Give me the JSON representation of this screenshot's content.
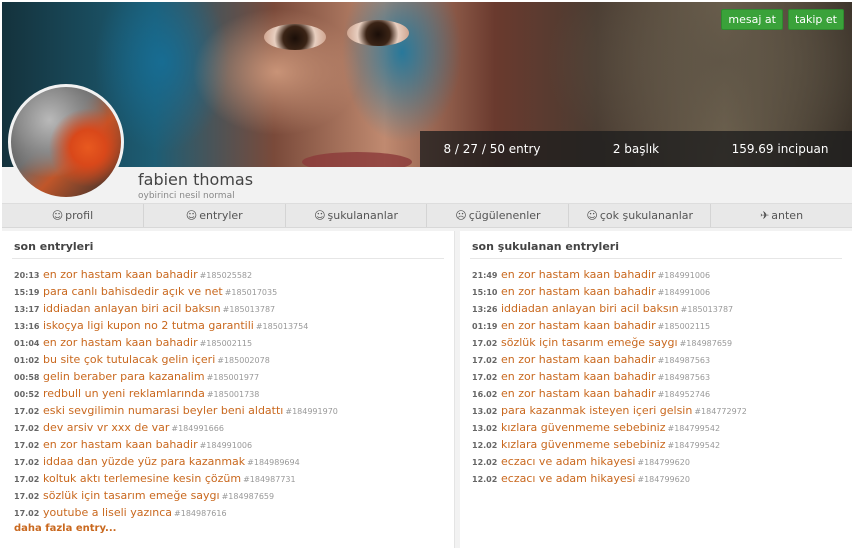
{
  "header": {
    "message_button": "mesaj at",
    "follow_button": "takip et"
  },
  "stats": {
    "entry_counts": "8 / 27 / 50 entry",
    "topics": "2 başlık",
    "points": "159.69 incipuan"
  },
  "profile": {
    "username": "fabien thomas",
    "generation": "oybirinci nesil normal"
  },
  "tabs": [
    {
      "icon": "☺",
      "label": "profil"
    },
    {
      "icon": "☺",
      "label": "entryler"
    },
    {
      "icon": "☺",
      "label": "şukulananlar"
    },
    {
      "icon": "☹",
      "label": "çügülenenler"
    },
    {
      "icon": "☺",
      "label": "çok şukulananlar"
    },
    {
      "icon": "✈",
      "label": "anten"
    }
  ],
  "left_panel": {
    "title": "son entryleri",
    "entries": [
      {
        "time": "20:13",
        "title": "en zor hastam kaan bahadir",
        "id": "#185025582"
      },
      {
        "time": "15:19",
        "title": "para canlı bahisdedir açık ve net",
        "id": "#185017035"
      },
      {
        "time": "13:17",
        "title": "iddiadan anlayan biri acil baksın",
        "id": "#185013787"
      },
      {
        "time": "13:16",
        "title": "iskoçya ligi kupon no 2 tutma garantili",
        "id": "#185013754"
      },
      {
        "time": "01:04",
        "title": "en zor hastam kaan bahadir",
        "id": "#185002115"
      },
      {
        "time": "01:02",
        "title": "bu site çok tutulacak gelin içeri",
        "id": "#185002078"
      },
      {
        "time": "00:58",
        "title": "gelin beraber para kazanalim",
        "id": "#185001977"
      },
      {
        "time": "00:52",
        "title": "redbull un yeni reklamlarında",
        "id": "#185001738"
      },
      {
        "time": "17.02",
        "title": "eski sevgilimin numarasi beyler beni aldattı",
        "id": "#184991970"
      },
      {
        "time": "17.02",
        "title": "dev arsiv vr xxx de var",
        "id": "#184991666"
      },
      {
        "time": "17.02",
        "title": "en zor hastam kaan bahadir",
        "id": "#184991006"
      },
      {
        "time": "17.02",
        "title": "iddaa dan yüzde yüz para kazanmak",
        "id": "#184989694"
      },
      {
        "time": "17.02",
        "title": "koltuk aktı terlemesine kesin çözüm",
        "id": "#184987731"
      },
      {
        "time": "17.02",
        "title": "sözlük için tasarım emeğe saygı",
        "id": "#184987659"
      },
      {
        "time": "17.02",
        "title": "youtube a liseli yazınca",
        "id": "#184987616"
      }
    ],
    "more_label": "daha fazla entry..."
  },
  "right_panel": {
    "title": "son şukulanan entryleri",
    "entries": [
      {
        "time": "21:49",
        "title": "en zor hastam kaan bahadir",
        "id": "#184991006"
      },
      {
        "time": "15:10",
        "title": "en zor hastam kaan bahadir",
        "id": "#184991006"
      },
      {
        "time": "13:26",
        "title": "iddiadan anlayan biri acil baksın",
        "id": "#185013787"
      },
      {
        "time": "01:19",
        "title": "en zor hastam kaan bahadir",
        "id": "#185002115"
      },
      {
        "time": "17.02",
        "title": "sözlük için tasarım emeğe saygı",
        "id": "#184987659"
      },
      {
        "time": "17.02",
        "title": "en zor hastam kaan bahadir",
        "id": "#184987563"
      },
      {
        "time": "17.02",
        "title": "en zor hastam kaan bahadir",
        "id": "#184987563"
      },
      {
        "time": "16.02",
        "title": "en zor hastam kaan bahadir",
        "id": "#184952746"
      },
      {
        "time": "13.02",
        "title": "para kazanmak isteyen içeri gelsin",
        "id": "#184772972"
      },
      {
        "time": "13.02",
        "title": "kızlara güvenmeme sebebiniz",
        "id": "#184799542"
      },
      {
        "time": "12.02",
        "title": "kızlara güvenmeme sebebiniz",
        "id": "#184799542"
      },
      {
        "time": "12.02",
        "title": "eczacı ve adam hikayesi",
        "id": "#184799620"
      },
      {
        "time": "12.02",
        "title": "eczacı ve adam hikayesi",
        "id": "#184799620"
      }
    ]
  },
  "colors": {
    "accent": "#c9681e",
    "button_green": "#3aa23a"
  }
}
